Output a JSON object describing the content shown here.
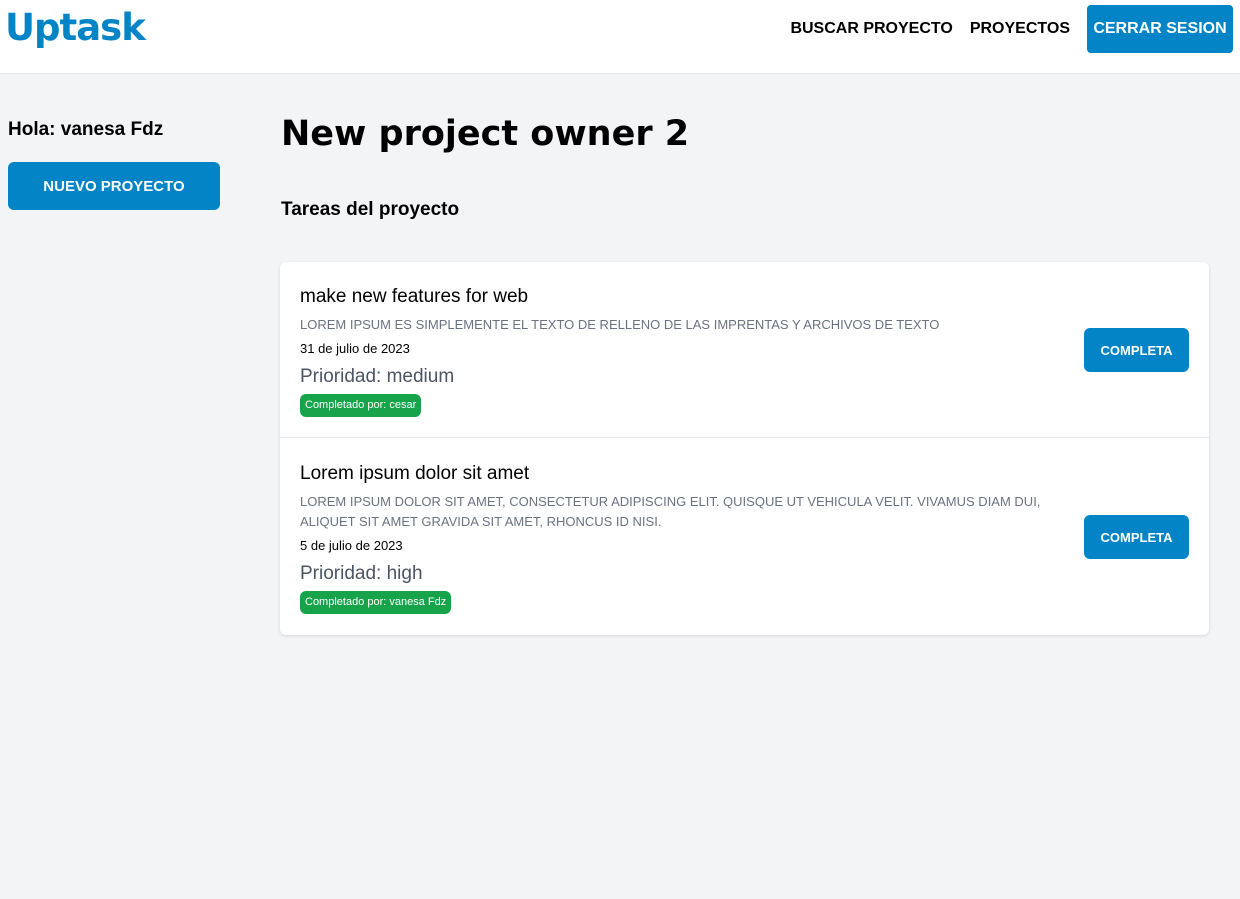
{
  "header": {
    "logo": "Uptask",
    "nav": {
      "search_label": "BUSCAR PROYECTO",
      "projects_label": "PROYECTOS",
      "logout_label": "CERRAR SESION"
    }
  },
  "sidebar": {
    "greeting": "Hola: vanesa Fdz",
    "new_project_label": "NUEVO PROYECTO"
  },
  "main": {
    "project_title": "New project owner 2",
    "tasks_heading": "Tareas del proyecto",
    "tasks": [
      {
        "name": "make new features for web",
        "description": "LOREM IPSUM ES SIMPLEMENTE EL TEXTO DE RELLENO DE LAS IMPRENTAS Y ARCHIVOS DE TEXTO",
        "date": "31 de julio de 2023",
        "priority": "Prioridad: medium",
        "completed_by": "Completado por: cesar",
        "action_label": "COMPLETA"
      },
      {
        "name": "Lorem ipsum dolor sit amet",
        "description": "LOREM IPSUM DOLOR SIT AMET, CONSECTETUR ADIPISCING ELIT. QUISQUE UT VEHICULA VELIT. VIVAMUS DIAM DUI, ALIQUET SIT AMET GRAVIDA SIT AMET, RHONCUS ID NISI.",
        "date": "5 de julio de 2023",
        "priority": "Prioridad: high",
        "completed_by": "Completado por: vanesa Fdz",
        "action_label": "COMPLETA"
      }
    ]
  },
  "colors": {
    "brand": "#0284c7",
    "success": "#16a34a",
    "background": "#f3f4f6"
  }
}
